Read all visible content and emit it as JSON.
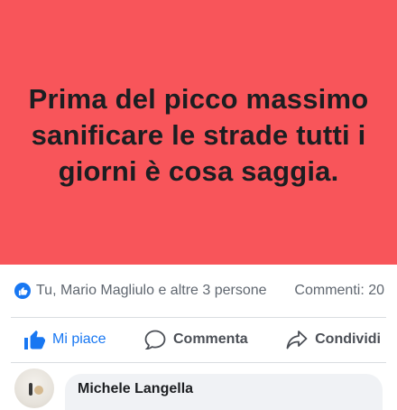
{
  "post": {
    "text": "Prima del picco massimo sanificare le strade tutti i giorni è cosa saggia.",
    "background_color": "#f8555a"
  },
  "reactions": {
    "summary": "Tu, Mario Magliulo e altre 3 persone",
    "comments_count": "Commenti: 20",
    "icon": "like-badge-icon"
  },
  "actions": {
    "like_label": "Mi piace",
    "comment_label": "Commenta",
    "share_label": "Condividi",
    "like_color": "#1877f2"
  },
  "comment": {
    "author": "Michele Langella"
  }
}
